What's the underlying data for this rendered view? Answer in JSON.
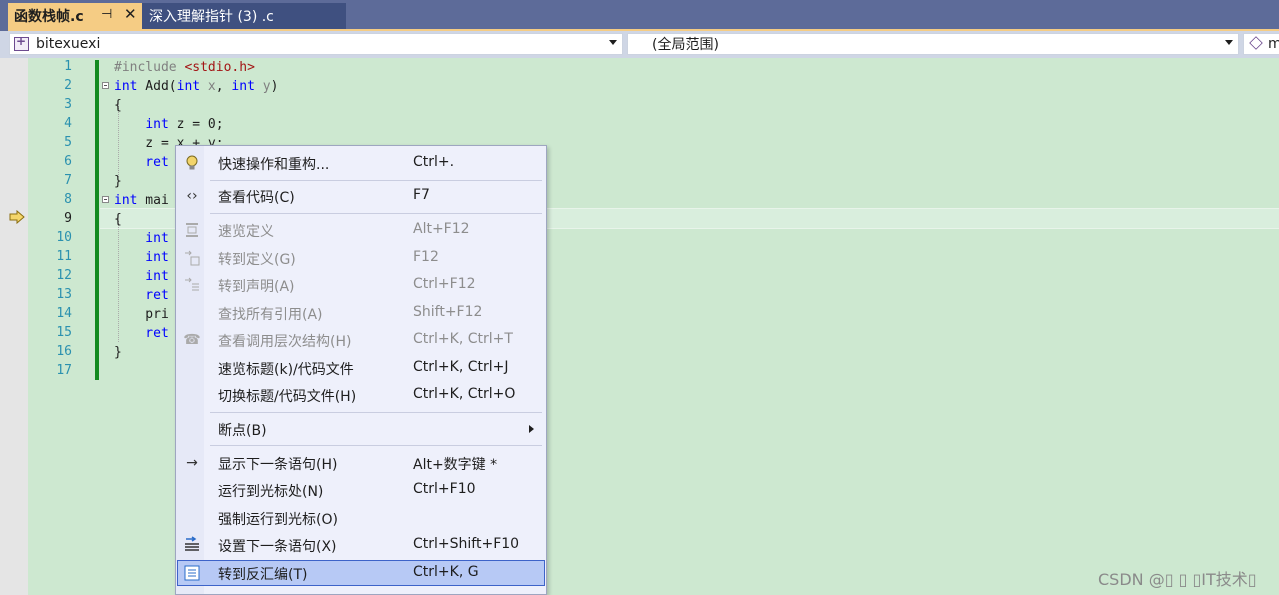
{
  "tabs": [
    {
      "title": "函数栈帧.c",
      "active": true,
      "pin_icon": "pin-icon",
      "close_icon": "close-icon"
    },
    {
      "title": "深入理解指针 (3) .c",
      "active": false
    }
  ],
  "navbar": {
    "project": "bitexuexi",
    "scope": "(全局范围)",
    "member": "m"
  },
  "editor": {
    "current_line": 9,
    "lines": [
      {
        "num": "1",
        "code": ""
      },
      {
        "num": "2",
        "code": ""
      },
      {
        "num": "3",
        "code": "{"
      },
      {
        "num": "4",
        "code": ""
      },
      {
        "num": "5",
        "code": "    z = x + y;"
      },
      {
        "num": "6",
        "code": "    ret"
      },
      {
        "num": "7",
        "code": "}"
      },
      {
        "num": "8",
        "code": ""
      },
      {
        "num": "9",
        "code": "{"
      },
      {
        "num": "10",
        "code": "    int"
      },
      {
        "num": "11",
        "code": "    int"
      },
      {
        "num": "12",
        "code": "    int"
      },
      {
        "num": "13",
        "code": "    ret"
      },
      {
        "num": "14",
        "code": "    pri"
      },
      {
        "num": "15",
        "code": "    ret"
      },
      {
        "num": "16",
        "code": "}"
      },
      {
        "num": "17",
        "code": ""
      }
    ],
    "tokens": {
      "l1_pp": "#include ",
      "l1_str": "<stdio.h>",
      "l2_kw1": "int",
      "l2_rest1": " Add(",
      "l2_kw2": "int",
      "l2_p1": " x",
      "l2_comma": ", ",
      "l2_kw3": "int",
      "l2_p2": " y",
      "l2_close": ")",
      "l4_kw": "int",
      "l4_rest": " z = 0;",
      "l8_kw": "int",
      "l8_rest": " mai"
    }
  },
  "context_menu": {
    "items": [
      {
        "icon": "lightbulb-icon",
        "label": "快速操作和重构...",
        "shortcut": "Ctrl+.",
        "disabled": false
      },
      {
        "icon": "code-brackets-icon",
        "label": "查看代码(C)",
        "shortcut": "F7",
        "disabled": false
      },
      {
        "icon": "peek-definition-icon",
        "label": "速览定义",
        "shortcut": "Alt+F12",
        "disabled": true
      },
      {
        "icon": "go-to-definition-icon",
        "label": "转到定义(G)",
        "shortcut": "F12",
        "disabled": true
      },
      {
        "icon": "go-to-declaration-icon",
        "label": "转到声明(A)",
        "shortcut": "Ctrl+F12",
        "disabled": true
      },
      {
        "icon": "",
        "label": "查找所有引用(A)",
        "shortcut": "Shift+F12",
        "disabled": true
      },
      {
        "icon": "call-hierarchy-icon",
        "label": "查看调用层次结构(H)",
        "shortcut": "Ctrl+K, Ctrl+T",
        "disabled": true
      },
      {
        "icon": "",
        "label": "速览标题(k)/代码文件",
        "shortcut": "Ctrl+K, Ctrl+J",
        "disabled": false
      },
      {
        "icon": "",
        "label": "切换标题/代码文件(H)",
        "shortcut": "Ctrl+K, Ctrl+O",
        "disabled": false
      },
      {
        "icon": "",
        "label": "断点(B)",
        "shortcut": "",
        "disabled": false,
        "submenu": true
      },
      {
        "icon": "right-arrow-icon",
        "label": "显示下一条语句(H)",
        "shortcut": "Alt+数字键 *",
        "disabled": false
      },
      {
        "icon": "",
        "label": "运行到光标处(N)",
        "shortcut": "Ctrl+F10",
        "disabled": false
      },
      {
        "icon": "",
        "label": "强制运行到光标(O)",
        "shortcut": "",
        "disabled": false
      },
      {
        "icon": "set-next-statement-icon",
        "label": "设置下一条语句(X)",
        "shortcut": "Ctrl+Shift+F10",
        "disabled": false
      },
      {
        "icon": "disassembly-icon",
        "label": "转到反汇编(T)",
        "shortcut": "Ctrl+K, G",
        "disabled": false,
        "selected": true
      }
    ]
  },
  "watermark": "CSDN @▯ ▯ ▯IT技术▯"
}
